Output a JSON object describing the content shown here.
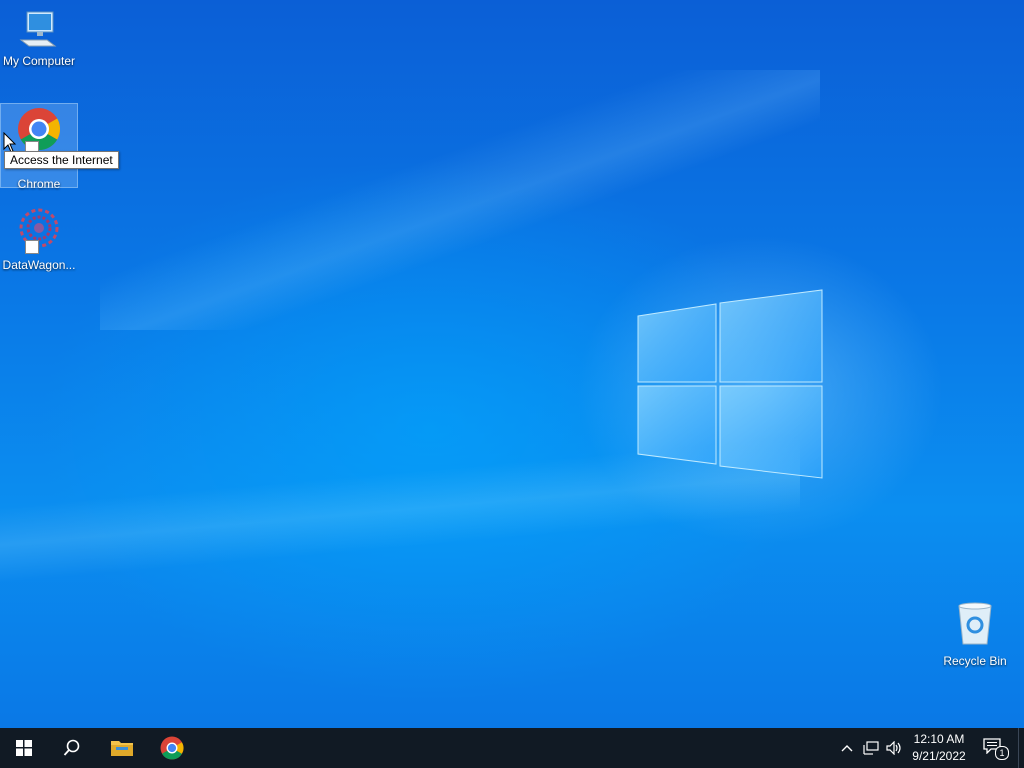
{
  "desktop": {
    "icons": [
      {
        "label": "My Computer"
      },
      {
        "label": "Chrome"
      },
      {
        "label": "DataWagon..."
      },
      {
        "label": "Recycle Bin"
      }
    ],
    "tooltip": "Access the Internet"
  },
  "taskbar": {
    "start_icon": "windows-start-icon",
    "search_icon": "search-icon",
    "pinned": [
      "file-explorer-icon",
      "chrome-icon"
    ],
    "clock": {
      "time": "12:10 AM",
      "date": "9/21/2022"
    },
    "notification_count": "1"
  },
  "colors": {
    "taskbar": "#111a24",
    "desktop_blue": "#0a78e6"
  }
}
